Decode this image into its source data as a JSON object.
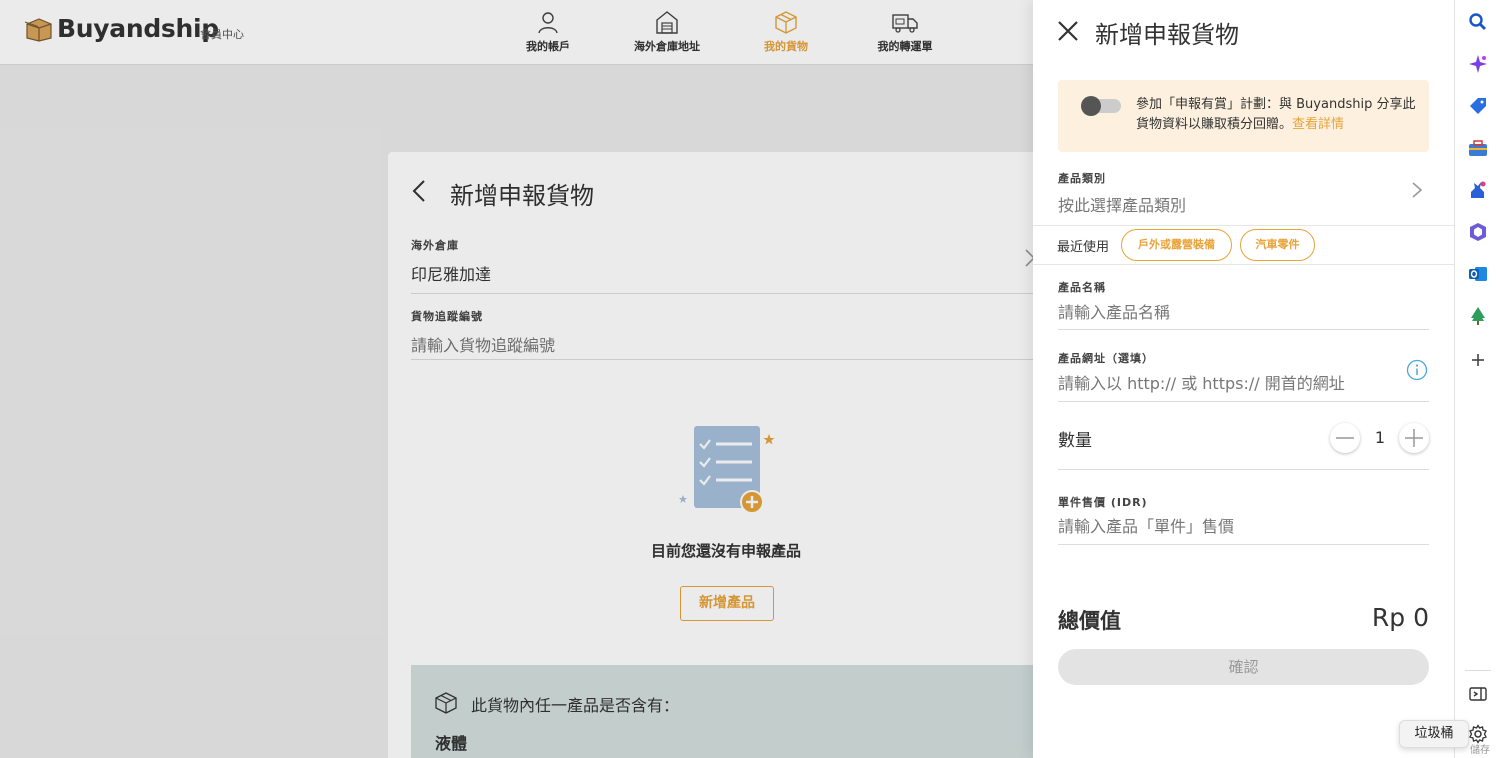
{
  "header": {
    "brand": "Buyandship",
    "brand_sub": "會員中心",
    "nav": [
      {
        "label": "我的帳戶",
        "icon": "user-icon",
        "active": false
      },
      {
        "label": "海外倉庫地址",
        "icon": "warehouse-icon",
        "active": false
      },
      {
        "label": "我的貨物",
        "icon": "package-icon",
        "active": true
      },
      {
        "label": "我的轉運單",
        "icon": "truck-icon",
        "active": false
      }
    ]
  },
  "card": {
    "title": "新增申報貨物",
    "warehouse_label": "海外倉庫",
    "warehouse_value": "印尼雅加達",
    "tracking_label": "貨物追蹤編號",
    "tracking_placeholder": "請輸入貨物追蹤編號",
    "empty_text": "目前您還沒有申報產品",
    "add_button": "新增產品",
    "notice_text": "此貨物內任一產品是否含有：",
    "notice_item": "液體"
  },
  "panel": {
    "title": "新增申報貨物",
    "promo_text": "參加「申報有賞」計劃：與 Buyandship 分享此貨物資料以賺取積分回贈。",
    "promo_link": "查看詳情",
    "category_label": "產品類別",
    "category_placeholder": "按此選擇產品類別",
    "recent_label": "最近使用",
    "recent_chips": [
      "戶外或露營裝備",
      "汽車零件"
    ],
    "name_label": "產品名稱",
    "name_placeholder": "請輸入產品名稱",
    "url_label": "產品網址（選填）",
    "url_placeholder": "請輸入以 http:// 或 https:// 開首的網址",
    "qty_label": "數量",
    "qty_value": "1",
    "price_label": "單件售價 (IDR)",
    "price_placeholder": "請輸入產品「單件」售價",
    "total_label": "總價值",
    "total_value": "Rp 0",
    "confirm_button": "確認"
  },
  "browser_sidebar": {
    "tooltip": "垃圾桶",
    "bottom_text": "儲存",
    "icons": [
      "search-icon",
      "copilot-icon",
      "shopping-tag-icon",
      "toolbox-icon",
      "games-icon",
      "office-icon",
      "outlook-icon",
      "tree-icon",
      "add-icon",
      "sidebar-toggle-icon",
      "settings-icon"
    ]
  },
  "colors": {
    "accent": "#e8a33a",
    "promo_bg": "#fdf0de",
    "notice_bg": "#d3dfde"
  }
}
